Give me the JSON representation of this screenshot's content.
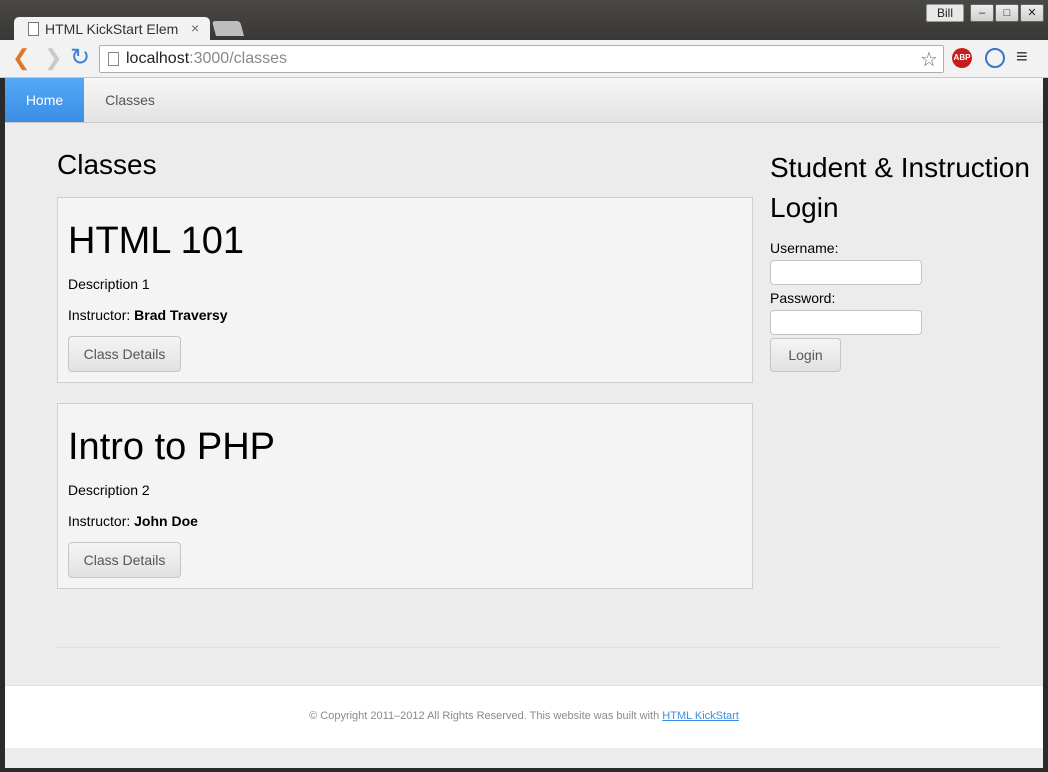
{
  "browser": {
    "tab_title": "HTML KickStart Elem",
    "tab_close": "×",
    "user": "Bill",
    "window_buttons": {
      "minimize": "–",
      "maximize": "□",
      "close": "✕"
    },
    "url_host": "localhost",
    "url_path": ":3000/classes",
    "icons": [
      "page-icon",
      "back-icon",
      "forward-icon",
      "reload-icon",
      "star-icon",
      "adblock-icon",
      "extension-icon",
      "menu-icon"
    ],
    "abp_label": "ABP"
  },
  "site_nav": {
    "items": [
      {
        "label": "Home",
        "active": true
      },
      {
        "label": "Classes",
        "active": false
      }
    ],
    "accent_color": "#4a9cf0"
  },
  "main": {
    "heading": "Classes",
    "instructor_label": "Instructor:",
    "classes": [
      {
        "title": "HTML 101",
        "description": "Description 1",
        "instructor": "Brad Traversy",
        "button": "Class Details"
      },
      {
        "title": "Intro to PHP",
        "description": "Description 2",
        "instructor": "John Doe",
        "button": "Class Details"
      }
    ]
  },
  "login": {
    "title": "Student & Instruction Login",
    "username_label": "Username:",
    "username_value": "",
    "password_label": "Password:",
    "password_value": "",
    "button": "Login"
  },
  "footer": {
    "text": "© Copyright 2011–2012 All Rights Reserved. This website was built with",
    "link": "HTML KickStart",
    "link_color": "#3a8ee6"
  }
}
